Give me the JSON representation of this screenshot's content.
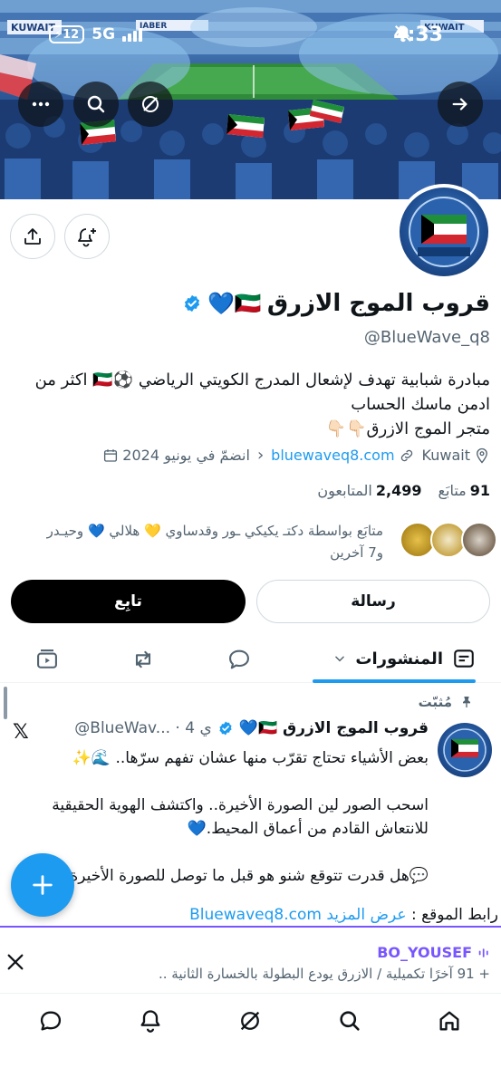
{
  "status_bar": {
    "battery": "12",
    "network": "5G",
    "time": "4:33"
  },
  "banner": {
    "sign_left": "KUWAIT",
    "sign_mid": "JABER",
    "sign_right": "KUWAIT"
  },
  "profile": {
    "name": "قروب الموج الازرق",
    "name_emojis": "🇰🇼💙",
    "handle": "@BlueWave_q8",
    "bio_line1": "مبادرة شبابية تهدف لإشعال المدرج الكويتي الرياضي ⚽️🇰🇼 اكثر من",
    "bio_line2": "ادمن ماسك الحساب",
    "bio_line3": "متجر الموج الازرق👇🏻👇🏻",
    "location": "Kuwait",
    "website": "bluewaveq8.com",
    "joined": "انضمّ في يونيو 2024",
    "following_count": "91",
    "following_label": "متابَع",
    "followers_count": "2,499",
    "followers_label": "المتابعون",
    "followed_by": "متابَع بواسطة دكتـ يكيكي ـور وقدساوي 💛 هلالي 💙 وحيـدر",
    "followed_by_more": "و7 آخرين"
  },
  "actions": {
    "message": "رسالة",
    "follow": "تابِع"
  },
  "tabs": {
    "posts": "المنشورات"
  },
  "tweet": {
    "pinned": "مُثبّت",
    "name": "قروب الموج الازرق 🇰🇼💙",
    "handle_time": "@BlueWav... · 4 ي",
    "body": "بعض الأشياء تحتاج تقرّب منها عشان تفهم سرّها.. 🌊✨\n\nاسحب الصور لين الصورة الأخيرة.. واكتشف الهوية الحقيقية للانتعاش القادم من أعماق المحيط.💙\n\n💬هل قدرت تتوقع شنو هو قبل ما توصل للصورة الأخيرة",
    "site_label": "رابط الموقع :",
    "show_more": "عرض المزيد",
    "site_url": "Bluewaveq8.com"
  },
  "now_playing": {
    "user": "BO_YOUSEF",
    "count": "+ 91 آخرًا",
    "title": "تكميلية / الازرق يودع البطولة بالخسارة الثانية .."
  },
  "colors": {
    "accent": "#1d9bf0",
    "space_purple": "#7856ff",
    "text": "#0f1419",
    "muted": "#536471"
  },
  "icons": [
    "back-arrow-icon",
    "verse-icon",
    "search-icon",
    "more-icon",
    "share-icon",
    "bell-plus-icon",
    "verified-icon",
    "location-icon",
    "link-icon",
    "calendar-icon",
    "posts-icon",
    "reply-icon",
    "repost-icon",
    "media-icon",
    "pin-icon",
    "x-logo-icon",
    "compose-plus-icon",
    "close-icon",
    "home-icon",
    "grok-icon",
    "notifications-icon",
    "messages-icon"
  ]
}
